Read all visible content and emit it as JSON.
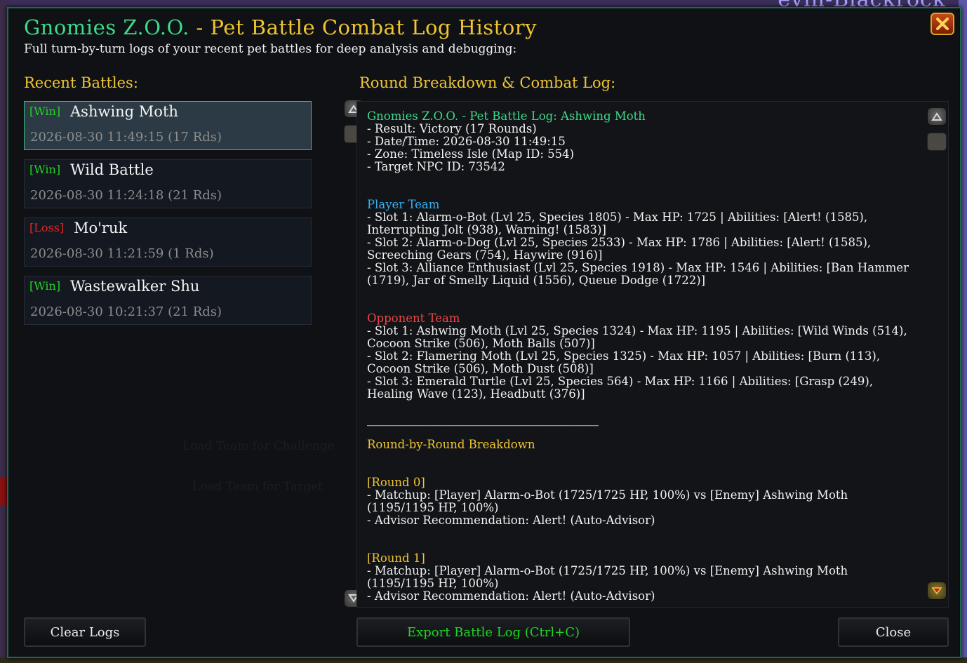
{
  "background": {
    "player_name": "evin-Blackrock"
  },
  "window": {
    "title_main": "Gnomies Z.O.O.",
    "title_rest": " - Pet Battle Combat Log History",
    "subtitle": "Full turn-by-turn logs of your recent pet battles for deep analysis and debugging:",
    "close_icon": "close-x-icon"
  },
  "left": {
    "label": "Recent Battles:",
    "battles": [
      {
        "result": "[Win]",
        "name": "Ashwing Moth",
        "meta": "2026-08-30 11:49:15 (17 Rds)"
      },
      {
        "result": "[Win]",
        "name": "Wild Battle",
        "meta": "2026-08-30 11:24:18 (21 Rds)"
      },
      {
        "result": "[Loss]",
        "name": "Mo'ruk",
        "meta": "2026-08-30 11:21:59 (1 Rds)"
      },
      {
        "result": "[Win]",
        "name": "Wastewalker Shu",
        "meta": "2026-08-30 10:21:37 (21 Rds)"
      }
    ],
    "ghost_texts": [
      "Load Team for Challenge",
      "Load Team for Target"
    ]
  },
  "right": {
    "label": "Round Breakdown & Combat Log:",
    "log": {
      "heading": "Gnomies Z.O.O. - Pet Battle Log: Ashwing Moth",
      "summary": [
        "- Result: Victory (17 Rounds)",
        "- Date/Time: 2026-08-30 11:49:15",
        "- Zone: Timeless Isle (Map ID: 554)",
        "- Target NPC ID: 73542"
      ],
      "player_team_label": "Player Team",
      "player_team": [
        "- Slot 1: Alarm-o-Bot (Lvl 25, Species 1805) - Max HP: 1725 | Abilities: [Alert! (1585), Interrupting Jolt (938), Warning! (1583)]",
        "- Slot 2: Alarm-o-Dog (Lvl 25, Species 2533) - Max HP: 1786 | Abilities: [Alert! (1585), Screeching Gears (754), Haywire (916)]",
        "- Slot 3: Alliance Enthusiast (Lvl 25, Species 1918) - Max HP: 1546 | Abilities: [Ban Hammer (1719), Jar of Smelly Liquid (1556), Queue Dodge (1722)]"
      ],
      "opponent_team_label": "Opponent Team",
      "opponent_team": [
        "- Slot 1: Ashwing Moth (Lvl 25, Species 1324) - Max HP: 1195 | Abilities: [Wild Winds (514), Cocoon Strike (506), Moth Balls (507)]",
        "- Slot 2: Flamering Moth (Lvl 25, Species 1325) - Max HP: 1057 | Abilities: [Burn (113), Cocoon Strike (506), Moth Dust (508)]",
        "- Slot 3: Emerald Turtle (Lvl 25, Species 564) - Max HP: 1166 | Abilities: [Grasp (249), Healing Wave (123), Headbutt (376)]"
      ],
      "divider": "________________________________________",
      "rounds_label": "Round-by-Round Breakdown",
      "rounds": [
        {
          "label": "[Round 0]",
          "lines": [
            "- Matchup: [Player] Alarm-o-Bot (1725/1725 HP, 100%) vs [Enemy] Ashwing Moth (1195/1195 HP, 100%)",
            "- Advisor Recommendation: Alert! (Auto-Advisor)"
          ]
        },
        {
          "label": "[Round 1]",
          "lines": [
            "- Matchup: [Player] Alarm-o-Bot (1725/1725 HP, 100%) vs [Enemy] Ashwing Moth (1195/1195 HP, 100%)",
            "- Advisor Recommendation: Alert! (Auto-Advisor)"
          ]
        }
      ]
    }
  },
  "buttons": {
    "clear": "Clear Logs",
    "export": "Export Battle Log (Ctrl+C)",
    "close": "Close"
  }
}
